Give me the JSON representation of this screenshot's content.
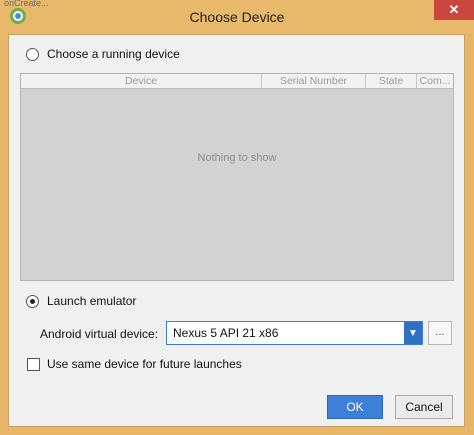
{
  "window": {
    "title": "Choose Device",
    "close_symbol": "✕",
    "app_icon": "android-studio-icon",
    "background_snippet": "onCreate..."
  },
  "running_device": {
    "label": "Choose a running device",
    "selected": false,
    "table": {
      "columns": [
        "Device",
        "Serial Number",
        "State",
        "Com..."
      ],
      "empty_message": "Nothing to show"
    }
  },
  "emulator": {
    "label": "Launch emulator",
    "selected": true,
    "avd_label": "Android virtual device:",
    "avd_value": "Nexus 5 API 21 x86",
    "more_button": "..."
  },
  "reuse": {
    "label": "Use same device for future launches",
    "checked": false
  },
  "buttons": {
    "ok": "OK",
    "cancel": "Cancel"
  },
  "colors": {
    "accent": "#3d7fd9",
    "titlebar": "#e8b86b",
    "close": "#c9473f"
  }
}
